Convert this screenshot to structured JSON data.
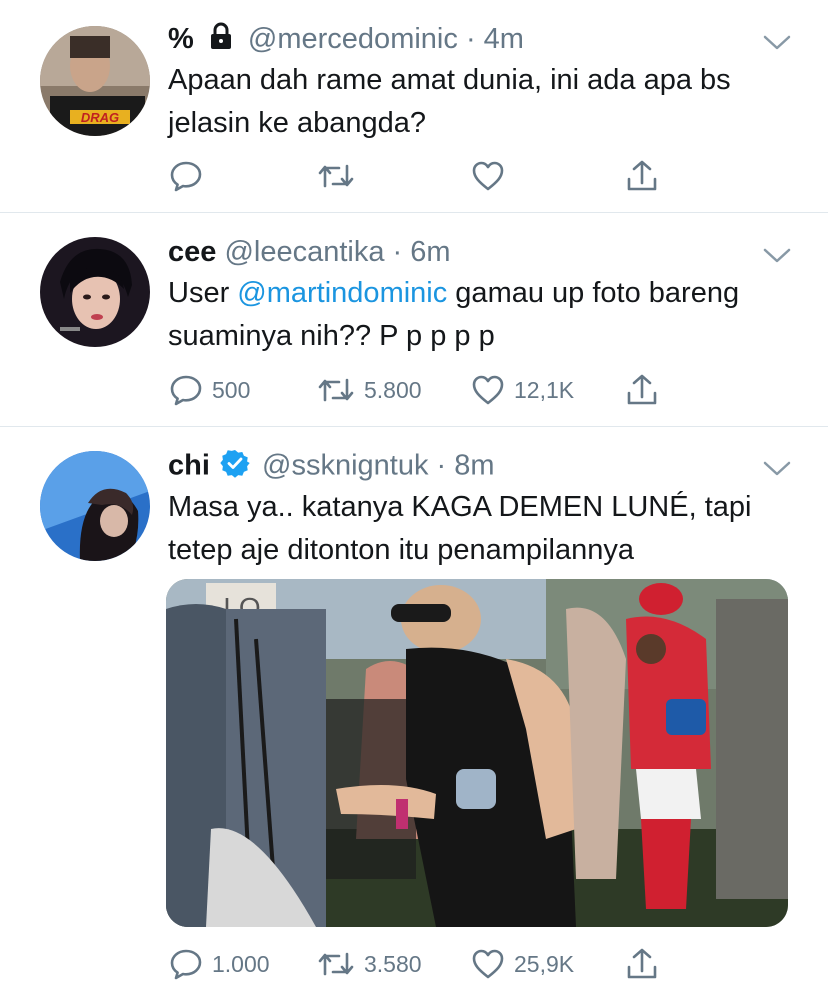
{
  "tweets": [
    {
      "name": "%",
      "locked": true,
      "handle": "@mercedominic",
      "dot": "·",
      "time": "4m",
      "text": "Apaan dah rame amat dunia, ini ada apa bs jelasin ke abangda?",
      "avatar_text": "DRAG",
      "counts": {
        "reply": "",
        "retweet": "",
        "like": ""
      }
    },
    {
      "name": "cee",
      "handle": "@leecantika",
      "dot": "·",
      "time": "6m",
      "text_prefix": "User ",
      "mention": "@martindominic",
      "text_suffix": " gamau up foto bareng suaminya nih?? P p p p p",
      "counts": {
        "reply": "500",
        "retweet": "5.800",
        "like": "12,1K"
      }
    },
    {
      "name": "chi",
      "verified": true,
      "handle": "@ssknigntuk",
      "dot": "·",
      "time": "8m",
      "text": "Masa ya.. katanya KAGA DEMEN LUNÉ, tapi tetep aje ditonton itu penampilannya",
      "photo_sign_text": "LO",
      "counts": {
        "reply": "1.000",
        "retweet": "3.580",
        "like": "25,9K"
      }
    }
  ],
  "colors": {
    "text": "#14171a",
    "secondary": "#657786",
    "link": "#1b95e0",
    "divider": "#e1e8ed",
    "verified": "#1da1f2"
  },
  "icons": [
    "chevron-down-icon",
    "reply-icon",
    "retweet-icon",
    "like-icon",
    "share-icon",
    "lock-icon",
    "verified-badge-icon"
  ]
}
